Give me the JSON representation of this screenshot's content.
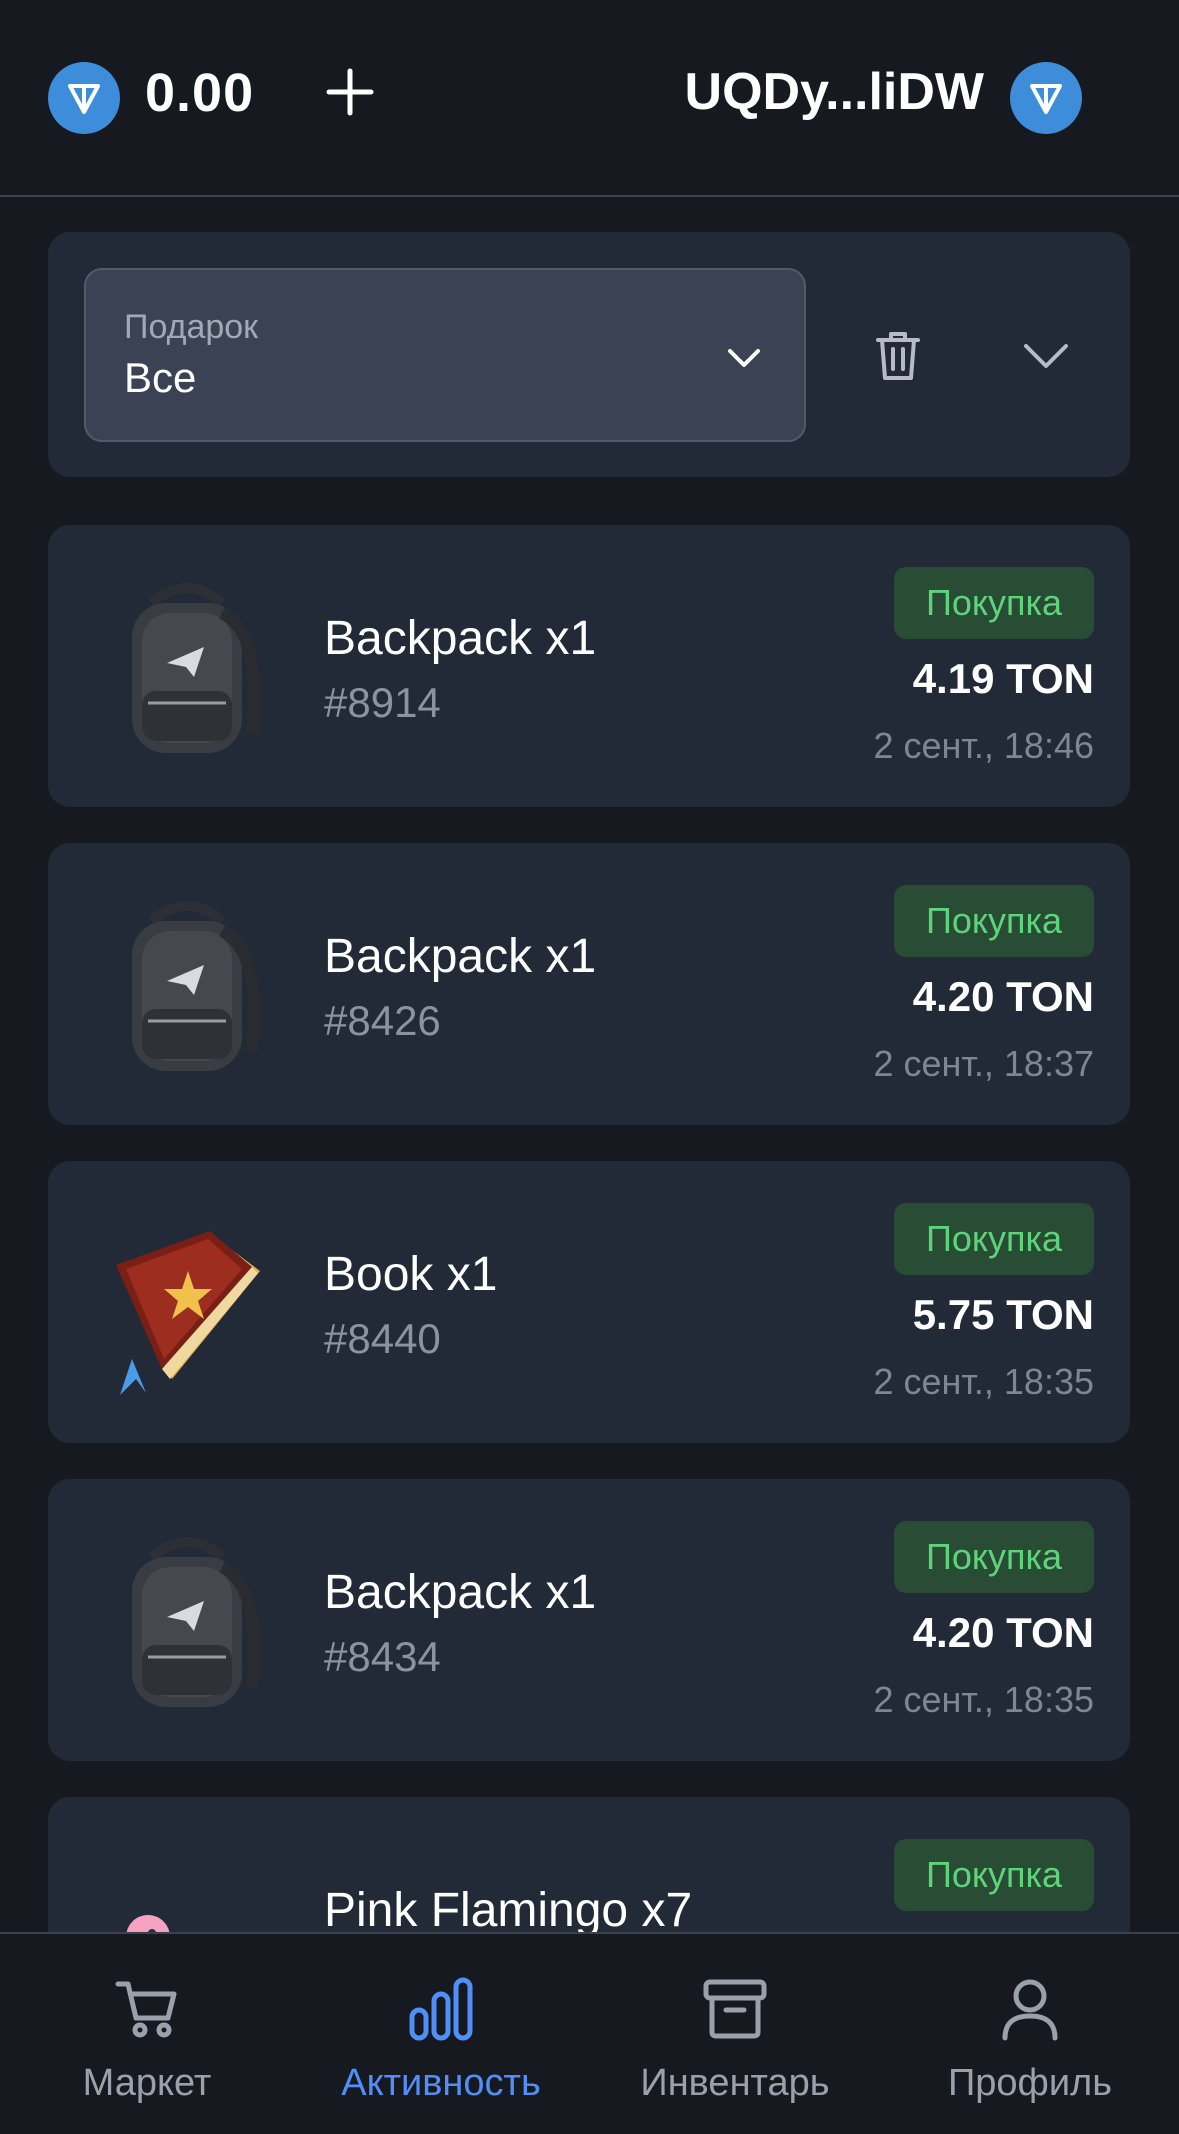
{
  "header": {
    "balance": "0.00",
    "wallet_address": "UQDy...liDW"
  },
  "filter": {
    "label": "Подарок",
    "value": "Все"
  },
  "activities": [
    {
      "title": "Backpack x1",
      "number": "#8914",
      "type": "Покупка",
      "price": "4.19 TON",
      "date": "2 сент., 18:46",
      "icon": "backpack-icon"
    },
    {
      "title": "Backpack x1",
      "number": "#8426",
      "type": "Покупка",
      "price": "4.20 TON",
      "date": "2 сент., 18:37",
      "icon": "backpack-icon"
    },
    {
      "title": "Book x1",
      "number": "#8440",
      "type": "Покупка",
      "price": "5.75 TON",
      "date": "2 сент., 18:35",
      "icon": "book-icon"
    },
    {
      "title": "Backpack x1",
      "number": "#8434",
      "type": "Покупка",
      "price": "4.20 TON",
      "date": "2 сент., 18:35",
      "icon": "backpack-icon"
    },
    {
      "title": "Pink Flamingo x7",
      "number": "",
      "type": "Покупка",
      "price": "",
      "date": "",
      "icon": "flamingo-icon"
    }
  ],
  "nav": [
    {
      "label": "Маркет",
      "icon": "cart-icon"
    },
    {
      "label": "Активность",
      "icon": "activity-chart-icon",
      "active": true
    },
    {
      "label": "Инвентарь",
      "icon": "archive-icon"
    },
    {
      "label": "Профиль",
      "icon": "user-icon"
    }
  ],
  "colors": {
    "background": "#16191f",
    "card": "#222a38",
    "accent": "#4f8ff7",
    "ton_blue": "#3d8ddb",
    "purchase_green": "#5fd37c",
    "purchase_bg": "#294c34"
  }
}
